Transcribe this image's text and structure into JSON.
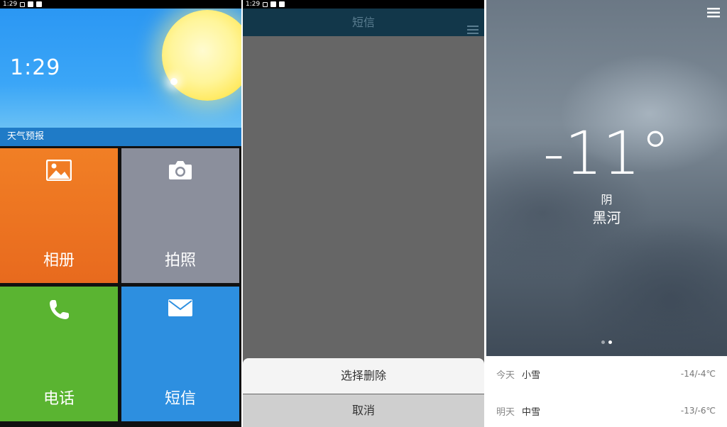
{
  "statusbar": {
    "time": "1:29"
  },
  "launcher": {
    "clock": "1:29",
    "weather_label": "天气预报",
    "tiles": [
      {
        "label": "相册",
        "icon": "photo-icon",
        "color": "#ec7422"
      },
      {
        "label": "拍照",
        "icon": "camera-icon",
        "color": "#8b8f9c"
      },
      {
        "label": "电话",
        "icon": "phone-icon",
        "color": "#5ab431"
      },
      {
        "label": "短信",
        "icon": "mail-icon",
        "color": "#2d8fe0"
      }
    ]
  },
  "sms": {
    "title": "短信",
    "sheet": {
      "delete_label": "选择删除",
      "cancel_label": "取消"
    }
  },
  "weather": {
    "temperature": "-11°",
    "condition": "阴",
    "city": "黑河",
    "page_count": 2,
    "active_page": 2,
    "forecast": [
      {
        "day": "今天",
        "weather": "小雪",
        "range": "-14/-4℃"
      },
      {
        "day": "明天",
        "weather": "中雪",
        "range": "-13/-6℃"
      }
    ]
  }
}
